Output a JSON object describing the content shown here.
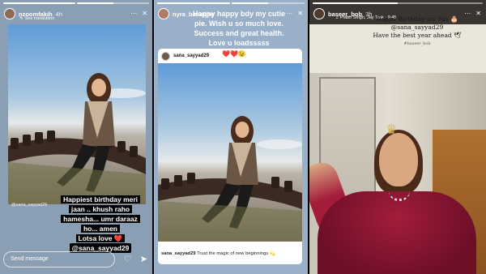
{
  "story1": {
    "username": "nzoomfakih",
    "time": "4h",
    "translate_label": "See translation",
    "photo_credit": "@sana_sayyad29",
    "caption_lines": [
      "Happiest birthday meri",
      "jaan .. khush raho",
      "hamesha... umr daraaz",
      "ho... amen",
      "Lotsa love ❤️"
    ],
    "mention": "@sana_sayyad29",
    "send_placeholder": "Send message",
    "progress": [
      1.0,
      0.5
    ]
  },
  "story2": {
    "username": "nyra_banerjee",
    "time": "",
    "top_text": "Happy happy bdy my cutie pie. Wish u so much love. Success and great health. Love u loadsssss",
    "shared_username": "sana_sayyad29",
    "shared_hearts": "❤️❤️😉",
    "footer_user": "sana_sayyad29",
    "footer_text": "Trust the magic of new beginnings 💫",
    "progress": [
      1.0,
      0.5
    ]
  },
  "story3": {
    "username": "baseer_bob",
    "time": "3h",
    "music": "♫ Prabh Singh, Jay Trak · 9:45",
    "script_line1": "Happy Birthday my Fav 🎂",
    "script_handle": "@sana_sayyad29",
    "script_line2": "Have the best year ahead 🕊",
    "script_tag": "#baseer_bob",
    "progress": [
      0.5
    ]
  },
  "icons": {
    "more": "⋯",
    "close": "✕",
    "heart": "♡",
    "send": "➤",
    "translate": "✎"
  },
  "colors": {
    "dress": "#8a1630",
    "crown": "#d8b24a",
    "heart_red": "#e0282e"
  }
}
